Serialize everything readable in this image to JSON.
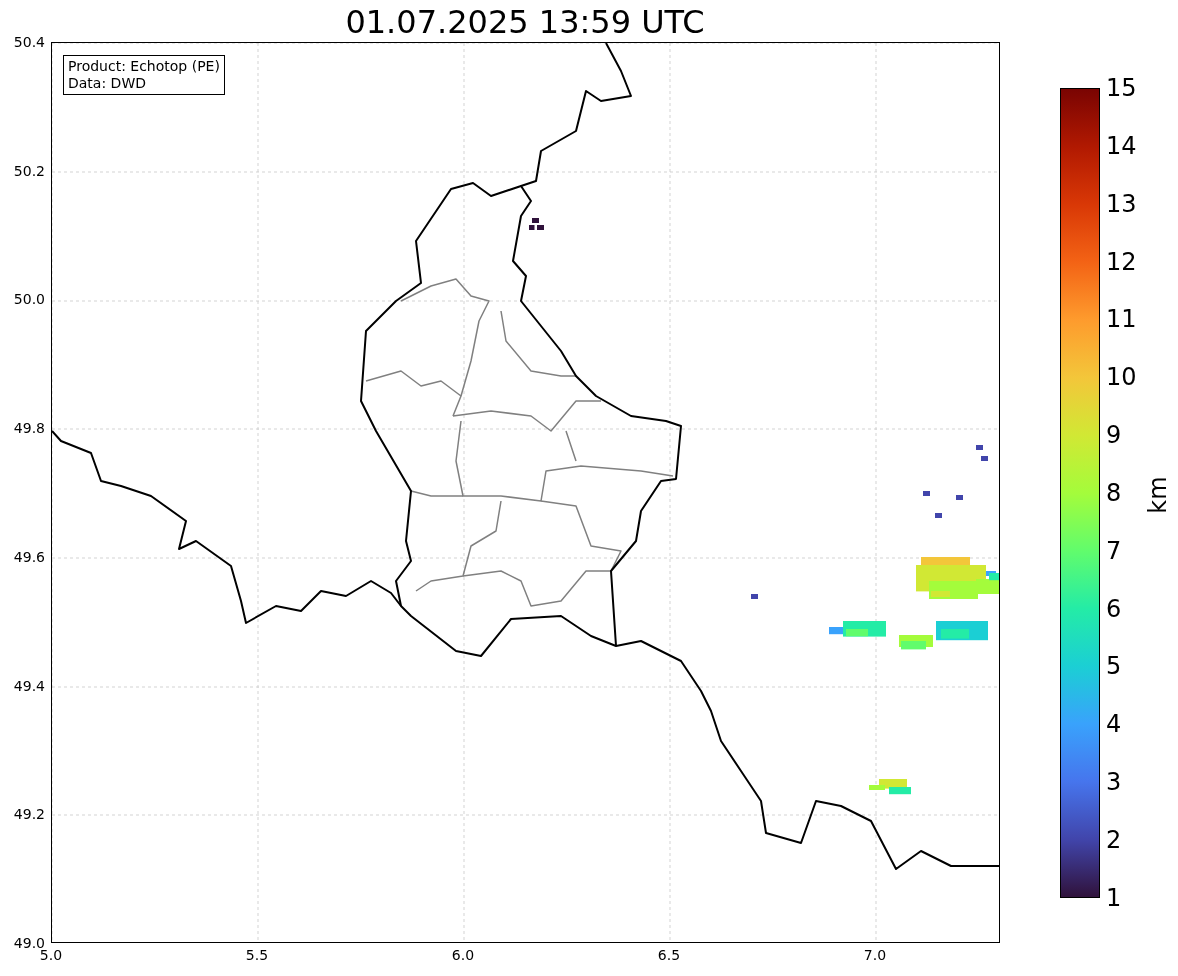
{
  "title": "01.07.2025 13:59 UTC",
  "info_box": [
    "Product: Echotop (PE)",
    "Data: DWD"
  ],
  "x_axis": {
    "ticks": [
      "5.0",
      "5.5",
      "6.0",
      "6.5",
      "7.0"
    ]
  },
  "y_axis": {
    "ticks": [
      "50.4",
      "50.2",
      "50.0",
      "49.8",
      "49.6",
      "49.4",
      "49.2",
      "49.0"
    ]
  },
  "colorbar": {
    "label": "km",
    "ticks": [
      "15",
      "14",
      "13",
      "12",
      "11",
      "10",
      "9",
      "8",
      "7",
      "6",
      "5",
      "4",
      "3",
      "2",
      "1"
    ]
  }
}
